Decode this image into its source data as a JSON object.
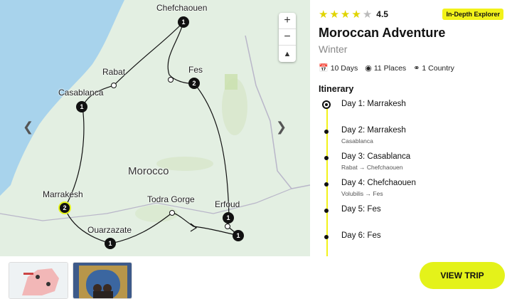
{
  "map": {
    "country": "Morocco",
    "cities": {
      "chefchaouen": "Chefchaouen",
      "rabat": "Rabat",
      "fes": "Fes",
      "casablanca": "Casablanca",
      "marrakesh": "Marrakesh",
      "todra_gorge": "Todra Gorge",
      "erfoud": "Erfoud",
      "ouarzazate": "Ouarzazate"
    },
    "markers": {
      "chefchaouen": "1",
      "fes": "2",
      "casablanca": "1",
      "marrakesh": "2",
      "erfoud": "1",
      "erfoud_south": "1",
      "ouarzazate": "1"
    },
    "zoom_in": "+",
    "zoom_out": "−"
  },
  "tour": {
    "rating": "4.5",
    "badge": "In-Depth Explorer",
    "title": "Moroccan Adventure",
    "season": "Winter",
    "days": "10 Days",
    "places": "11 Places",
    "countries": "1 Country"
  },
  "itinerary": {
    "heading": "Itinerary",
    "days": [
      {
        "title": "Day 1: Marrakesh",
        "sub": ""
      },
      {
        "title": "Day 2: Marrakesh",
        "sub": "Casablanca"
      },
      {
        "title": "Day 3: Casablanca",
        "sub": "Rabat → Chefchaouen"
      },
      {
        "title": "Day 4: Chefchaouen",
        "sub": "Volubilis → Fes"
      },
      {
        "title": "Day 5: Fes",
        "sub": ""
      },
      {
        "title": "Day 6: Fes",
        "sub": ""
      }
    ]
  },
  "cta": {
    "label": "VIEW TRIP"
  },
  "colors": {
    "accent": "#e4f21a",
    "sea": "#a8d3ec",
    "land": "#e3efe2"
  }
}
